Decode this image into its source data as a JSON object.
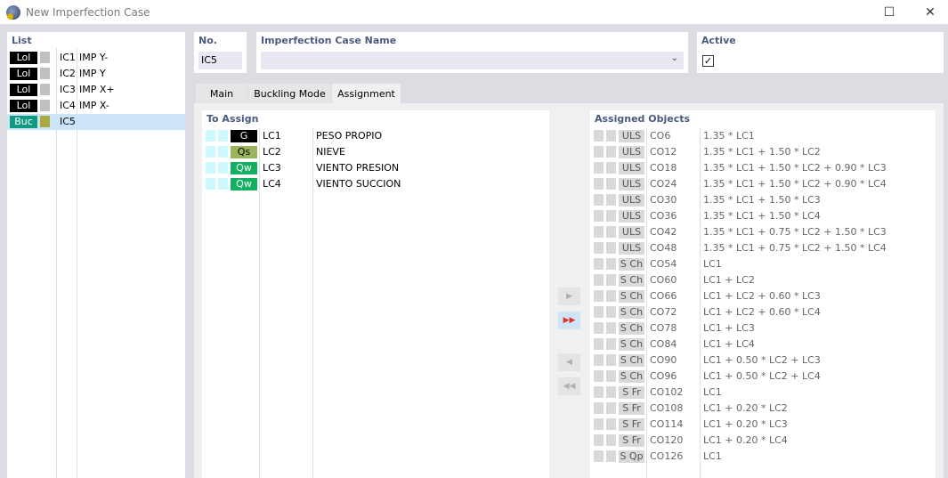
{
  "window": {
    "title": "New Imperfection Case"
  },
  "list": {
    "header": "List",
    "items": [
      {
        "type": "Lol",
        "type_color": "#000000",
        "square_color": "#c0c0c0",
        "id": "IC1",
        "name": "IMP Y-"
      },
      {
        "type": "Lol",
        "type_color": "#000000",
        "square_color": "#c0c0c0",
        "id": "IC2",
        "name": "IMP Y"
      },
      {
        "type": "Lol",
        "type_color": "#000000",
        "square_color": "#c0c0c0",
        "id": "IC3",
        "name": "IMP X+"
      },
      {
        "type": "Lol",
        "type_color": "#000000",
        "square_color": "#c0c0c0",
        "id": "IC4",
        "name": "IMP X-"
      },
      {
        "type": "Buc",
        "type_color": "#0f9a82",
        "square_color": "#a9ab40",
        "id": "IC5",
        "name": "",
        "selected": true
      }
    ]
  },
  "no": {
    "label": "No.",
    "value": "IC5"
  },
  "name": {
    "label": "Imperfection Case Name",
    "value": ""
  },
  "active": {
    "label": "Active",
    "checked": true,
    "check_glyph": "✓"
  },
  "tabs": [
    {
      "label": "Main"
    },
    {
      "label": "Buckling Mode"
    },
    {
      "label": "Assignment",
      "active": true
    }
  ],
  "to_assign": {
    "header": "To Assign",
    "items": [
      {
        "badge": "G",
        "badge_bg": "#000000",
        "badge_fg": "#ffffff",
        "id": "LC1",
        "name": "PESO PROPIO"
      },
      {
        "badge": "Qs",
        "badge_bg": "#9bb55a",
        "badge_fg": "#000000",
        "id": "LC2",
        "name": "NIEVE"
      },
      {
        "badge": "Qw",
        "badge_bg": "#12b060",
        "badge_fg": "#ffffff",
        "id": "LC3",
        "name": "VIENTO PRESION"
      },
      {
        "badge": "Qw",
        "badge_bg": "#12b060",
        "badge_fg": "#ffffff",
        "id": "LC4",
        "name": "VIENTO SUCCION"
      }
    ]
  },
  "buttons": {
    "assign_one": "▶",
    "assign_all": "▶▶",
    "remove_one": "◀",
    "remove_all": "◀◀"
  },
  "assigned": {
    "header": "Assigned Objects",
    "items": [
      {
        "badge": "ULS",
        "id": "CO6",
        "formula": "1.35 * LC1"
      },
      {
        "badge": "ULS",
        "id": "CO12",
        "formula": "1.35 * LC1 + 1.50 * LC2"
      },
      {
        "badge": "ULS",
        "id": "CO18",
        "formula": "1.35 * LC1 + 1.50 * LC2 + 0.90 * LC3"
      },
      {
        "badge": "ULS",
        "id": "CO24",
        "formula": "1.35 * LC1 + 1.50 * LC2 + 0.90 * LC4"
      },
      {
        "badge": "ULS",
        "id": "CO30",
        "formula": "1.35 * LC1 + 1.50 * LC3"
      },
      {
        "badge": "ULS",
        "id": "CO36",
        "formula": "1.35 * LC1 + 1.50 * LC4"
      },
      {
        "badge": "ULS",
        "id": "CO42",
        "formula": "1.35 * LC1 + 0.75 * LC2 + 1.50 * LC3"
      },
      {
        "badge": "ULS",
        "id": "CO48",
        "formula": "1.35 * LC1 + 0.75 * LC2 + 1.50 * LC4"
      },
      {
        "badge": "S Ch",
        "id": "CO54",
        "formula": "LC1"
      },
      {
        "badge": "S Ch",
        "id": "CO60",
        "formula": "LC1 + LC2"
      },
      {
        "badge": "S Ch",
        "id": "CO66",
        "formula": "LC1 + LC2 + 0.60 * LC3"
      },
      {
        "badge": "S Ch",
        "id": "CO72",
        "formula": "LC1 + LC2 + 0.60 * LC4"
      },
      {
        "badge": "S Ch",
        "id": "CO78",
        "formula": "LC1 + LC3"
      },
      {
        "badge": "S Ch",
        "id": "CO84",
        "formula": "LC1 + LC4"
      },
      {
        "badge": "S Ch",
        "id": "CO90",
        "formula": "LC1 + 0.50 * LC2 + LC3"
      },
      {
        "badge": "S Ch",
        "id": "CO96",
        "formula": "LC1 + 0.50 * LC2 + LC4"
      },
      {
        "badge": "S Fr",
        "id": "CO102",
        "formula": "LC1"
      },
      {
        "badge": "S Fr",
        "id": "CO108",
        "formula": "LC1 + 0.20 * LC2"
      },
      {
        "badge": "S Fr",
        "id": "CO114",
        "formula": "LC1 + 0.20 * LC3"
      },
      {
        "badge": "S Fr",
        "id": "CO120",
        "formula": "LC1 + 0.20 * LC4"
      },
      {
        "badge": "S Qp",
        "id": "CO126",
        "formula": "LC1"
      }
    ]
  }
}
